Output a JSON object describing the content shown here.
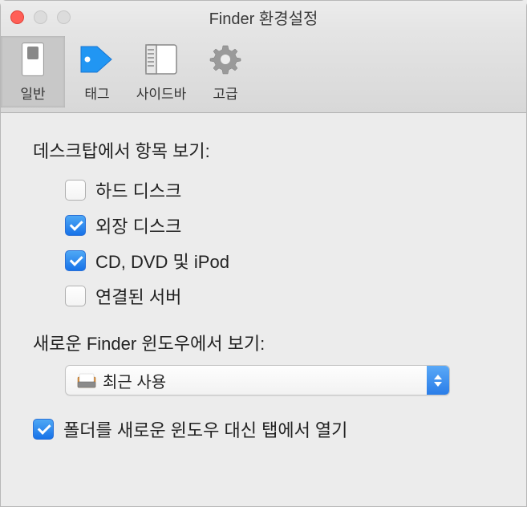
{
  "window": {
    "title": "Finder 환경설정"
  },
  "toolbar": {
    "items": [
      {
        "label": "일반",
        "selected": true
      },
      {
        "label": "태그",
        "selected": false
      },
      {
        "label": "사이드바",
        "selected": false
      },
      {
        "label": "고급",
        "selected": false
      }
    ]
  },
  "sections": {
    "desktop_items": {
      "title": "데스크탑에서 항목 보기:",
      "options": [
        {
          "label": "하드 디스크",
          "checked": false
        },
        {
          "label": "외장 디스크",
          "checked": true
        },
        {
          "label": "CD, DVD 및 iPod",
          "checked": true
        },
        {
          "label": "연결된 서버",
          "checked": false
        }
      ]
    },
    "new_window": {
      "title": "새로운 Finder 윈도우에서 보기:",
      "selected": "최근 사용"
    },
    "tabs_option": {
      "label": "폴더를 새로운 윈도우 대신 탭에서 열기",
      "checked": true
    }
  }
}
